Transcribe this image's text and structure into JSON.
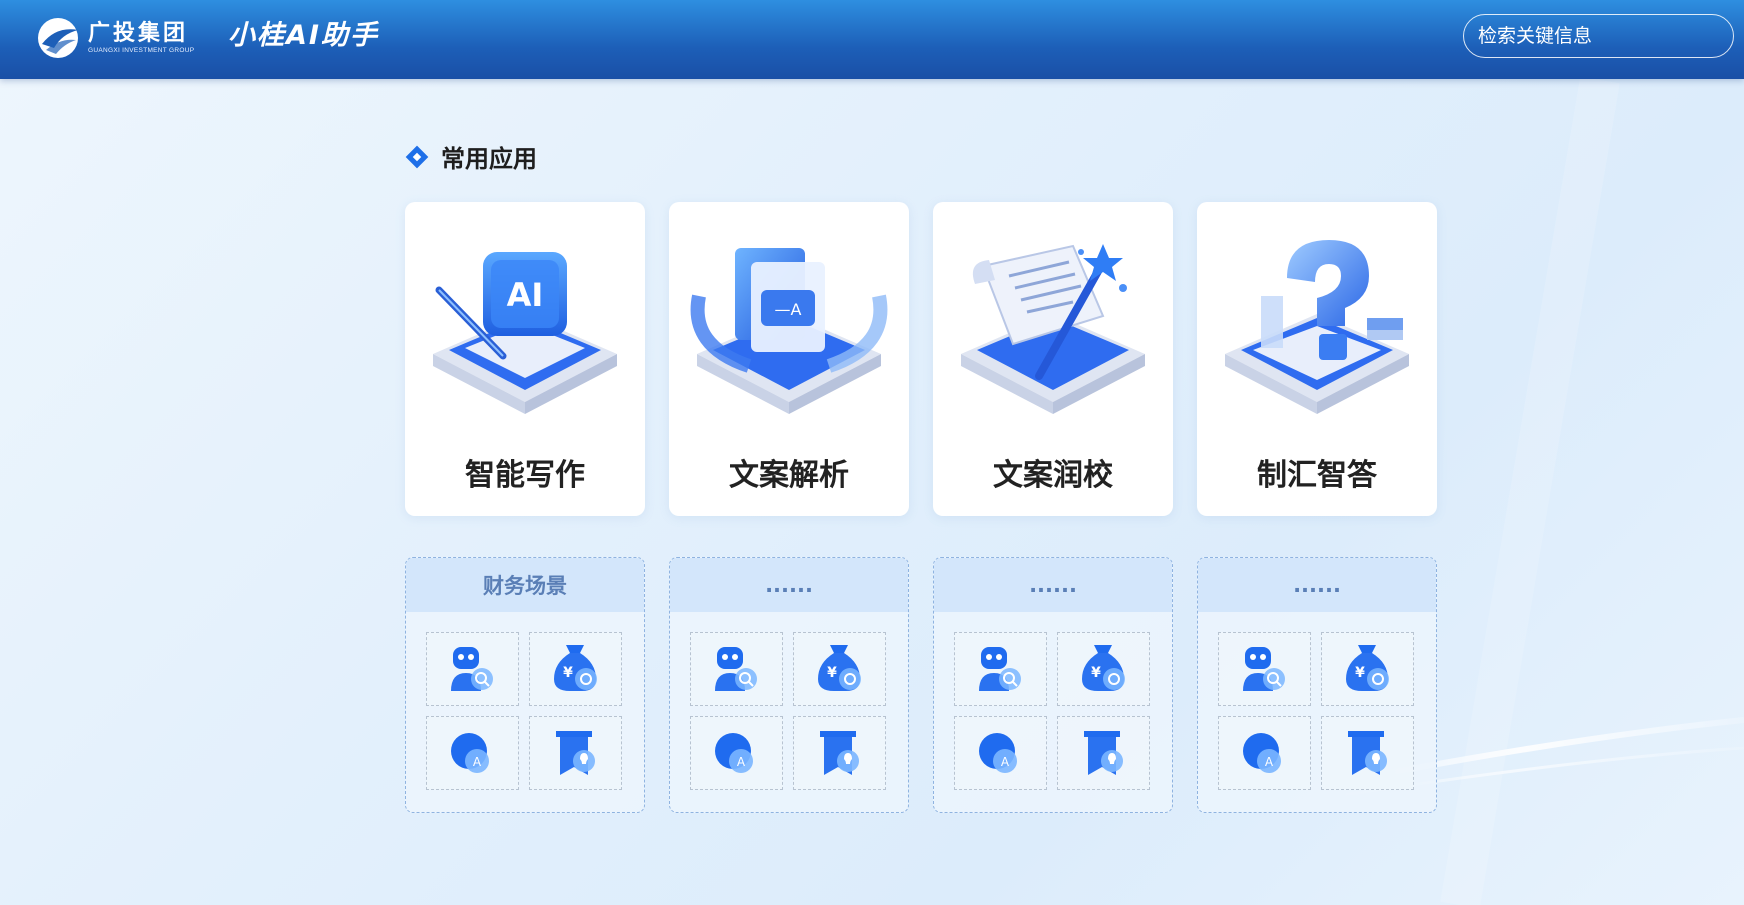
{
  "header": {
    "logo_cn": "广投集团",
    "logo_en": "GUANGXI INVESTMENT GROUP",
    "app_title": "小桂AI助手",
    "search_placeholder": "检索关键信息"
  },
  "section": {
    "title": "常用应用"
  },
  "apps": [
    {
      "label": "智能写作",
      "icon": "ai-writing-icon"
    },
    {
      "label": "文案解析",
      "icon": "document-analysis-icon"
    },
    {
      "label": "文案润校",
      "icon": "document-polish-icon"
    },
    {
      "label": "制汇智答",
      "icon": "question-answer-icon"
    }
  ],
  "scenes": [
    {
      "title": "财务场景"
    },
    {
      "title": "......"
    },
    {
      "title": "......"
    },
    {
      "title": "......"
    }
  ],
  "scene_icons": [
    "robot-search-icon",
    "money-bag-icon",
    "ai-chat-icon",
    "bookmark-idea-icon"
  ],
  "colors": {
    "header": "#1d5fb8",
    "accent": "#1e6fe8",
    "scene_title": "#5a7fb6"
  }
}
